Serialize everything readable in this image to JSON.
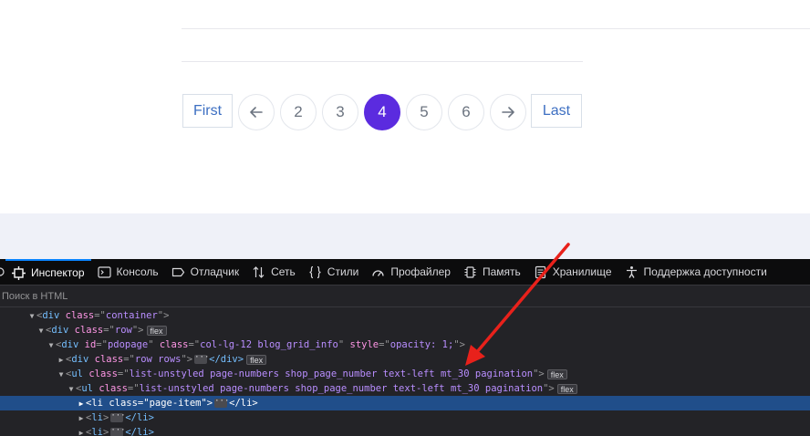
{
  "pagination": {
    "first_label": "First",
    "last_label": "Last",
    "prev_icon": "arrow-left-icon",
    "next_icon": "arrow-right-icon",
    "pages": [
      "2",
      "3",
      "4",
      "5",
      "6"
    ],
    "active_page": "4",
    "accent_color": "#5b2bdf"
  },
  "devtools": {
    "tabs": [
      {
        "icon": "inspector-icon",
        "label": "Инспектор"
      },
      {
        "icon": "console-icon",
        "label": "Консоль"
      },
      {
        "icon": "debugger-icon",
        "label": "Отладчик"
      },
      {
        "icon": "network-icon",
        "label": "Сеть"
      },
      {
        "icon": "style-editor-icon",
        "label": "Стили"
      },
      {
        "icon": "profiler-icon",
        "label": "Профайлер"
      },
      {
        "icon": "memory-icon",
        "label": "Память"
      },
      {
        "icon": "storage-icon",
        "label": "Хранилище"
      },
      {
        "icon": "accessibility-icon",
        "label": "Поддержка доступности"
      }
    ],
    "active_tab": "Инспектор",
    "search_placeholder": "Поиск в HTML",
    "tree": {
      "r1": {
        "tag": "div",
        "attr": "class",
        "val": "container"
      },
      "r2": {
        "tag": "div",
        "attr": "class",
        "val": "row",
        "badge": "flex"
      },
      "r3": {
        "tag": "div",
        "attr1": "id",
        "val1": "pdopage",
        "attr2": "class",
        "val2": "col-lg-12 blog_grid_info",
        "attr3": "style",
        "val3": "opacity: 1;"
      },
      "r4": {
        "tag": "div",
        "attr": "class",
        "val": "row rows",
        "close": "</div>",
        "badge": "flex"
      },
      "r5": {
        "tag": "ul",
        "attr": "class",
        "val": "list-unstyled page-numbers shop_page_number text-left mt_30 pagination",
        "badge": "flex"
      },
      "r6": {
        "tag": "ul",
        "attr": "class",
        "val": "list-unstyled page-numbers shop_page_number text-left mt_30 pagination",
        "badge": "flex"
      },
      "r7": {
        "tag": "li",
        "attr": "class",
        "val": "page-item",
        "close": "</li>"
      },
      "r8": {
        "tag": "li",
        "close": "</li>"
      },
      "r9": {
        "tag": "li",
        "close": "</li>"
      }
    },
    "selected_row": "r7"
  },
  "colors": {
    "annotation_arrow": "#e8211b"
  }
}
